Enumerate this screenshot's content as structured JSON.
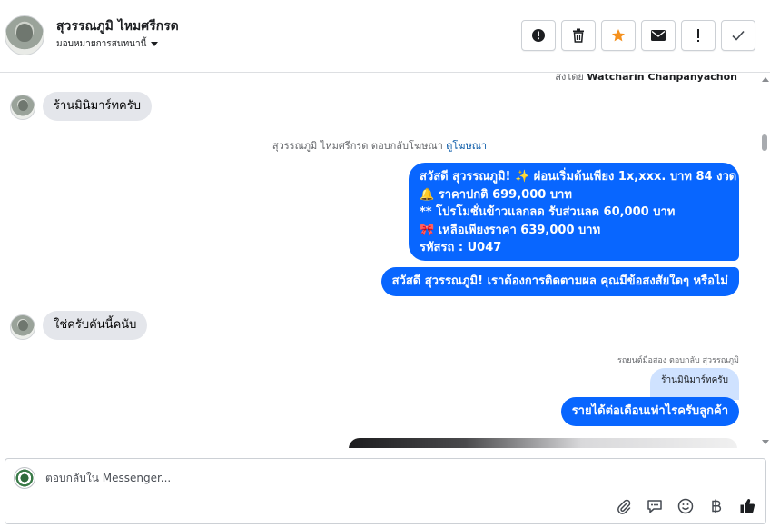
{
  "header": {
    "contact_name": "สุวรรณภูมิ ไหมศรีกรด",
    "assign_label": "มอบหมายการสนทนานี้"
  },
  "toolbar": {
    "buttons": [
      {
        "name": "alert-icon",
        "glyph": "●"
      },
      {
        "name": "trash-icon",
        "glyph": "🗑"
      },
      {
        "name": "star-icon",
        "glyph": "★"
      },
      {
        "name": "envelope-icon",
        "glyph": "✉"
      },
      {
        "name": "exclamation-icon",
        "glyph": "!"
      },
      {
        "name": "check-icon",
        "glyph": "✓"
      }
    ]
  },
  "thread": {
    "top_cut": {
      "prefix": "ส่งโดย",
      "sender": "Watcharin Chanpanyachon"
    },
    "msg1": "ร้านมินิมาร์ทครับ",
    "ad_note": {
      "text": "สุวรรณภูมิ ไหมศรีกรด ตอบกลับโฆษณา",
      "link": "ดูโฆษณา"
    },
    "promo_lines": [
      "สวัสดี สุวรรณภูมิ! ✨  ผ่อนเริ่มต้นเพียง 1x,xxx. บาท 84 งวด",
      "🔔 ราคาปกติ 699,000 บาท",
      "** โปรโมชั่นข้าวแลกลด รับส่วนลด 60,000 บาท",
      "🎀  เหลือเพียงราคา 639,000 บาท",
      " รหัสรถ : U047"
    ],
    "followup": "สวัสดี สุวรรณภูมิ! เราต้องการติดตามผล คุณมีข้อสงสัยใดๆ หรือไม่",
    "msg2": "ใช่ครับคันนี้คนับ",
    "reply_meta": "รถยนต์มือสอง ตอบกลับ สุวรรณภูมิ",
    "reply_quote": "ร้านมินิมาร์ทครับ",
    "reply_text": "รายได้ต่อเดือนเท่าไรครับลูกค้า"
  },
  "composer": {
    "placeholder": "ตอบกลับใน Messenger...",
    "icons": [
      "paperclip-icon",
      "speech-bubble-icon",
      "emoji-icon",
      "baht-icon",
      "thumbs-up-icon"
    ]
  },
  "colors": {
    "accent": "#0866ff",
    "incoming_bubble": "#e4e6eb",
    "star": "#f5911e"
  }
}
